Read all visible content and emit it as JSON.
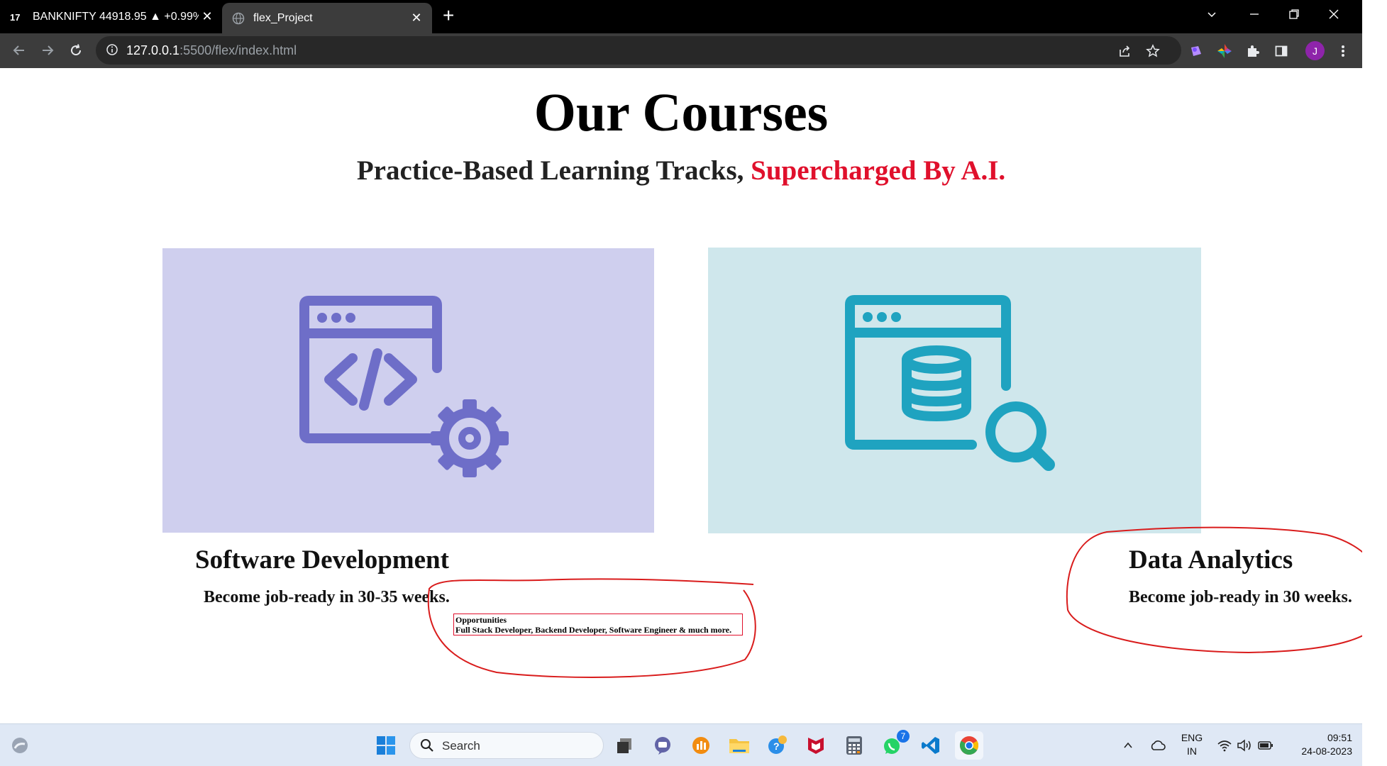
{
  "browser": {
    "tabs": [
      {
        "title": "BANKNIFTY 44918.95 ▲ +0.99%",
        "favicon": "tradingview-icon",
        "active": false
      },
      {
        "title": "flex_Project",
        "favicon": "globe-icon",
        "active": true
      }
    ],
    "close_glyph": "✕",
    "new_tab_glyph": "+",
    "url_host": "127.0.0.1",
    "url_path": ":5500/flex/index.html",
    "profile_initial": "J"
  },
  "page": {
    "title": "Our Courses",
    "subtitle_plain": "Practice-Based Learning Tracks, ",
    "subtitle_accent": "Supercharged By A.I.",
    "accent_color": "#e0102c",
    "courses": [
      {
        "title": "Software Development",
        "description": "Become job-ready in 30-35 weeks.",
        "icon": "code-window-gear-icon",
        "bg": "#cfcfee",
        "icon_color": "#6e6ec8"
      },
      {
        "title": "Data Analytics",
        "description": "Become job-ready in 30 weeks.",
        "icon": "database-search-window-icon",
        "bg": "#cfe7ec",
        "icon_color": "#1fa3c0"
      }
    ],
    "tooltip": {
      "heading": "Opportunities",
      "text": "Full Stack Developer, Backend Developer, Software Engineer & much more."
    },
    "annotation_color": "#d91c1c"
  },
  "taskbar": {
    "search_placeholder": "Search",
    "whatsapp_badge": "7",
    "language_line1": "ENG",
    "language_line2": "IN",
    "time": "09:51",
    "date": "24-08-2023"
  }
}
